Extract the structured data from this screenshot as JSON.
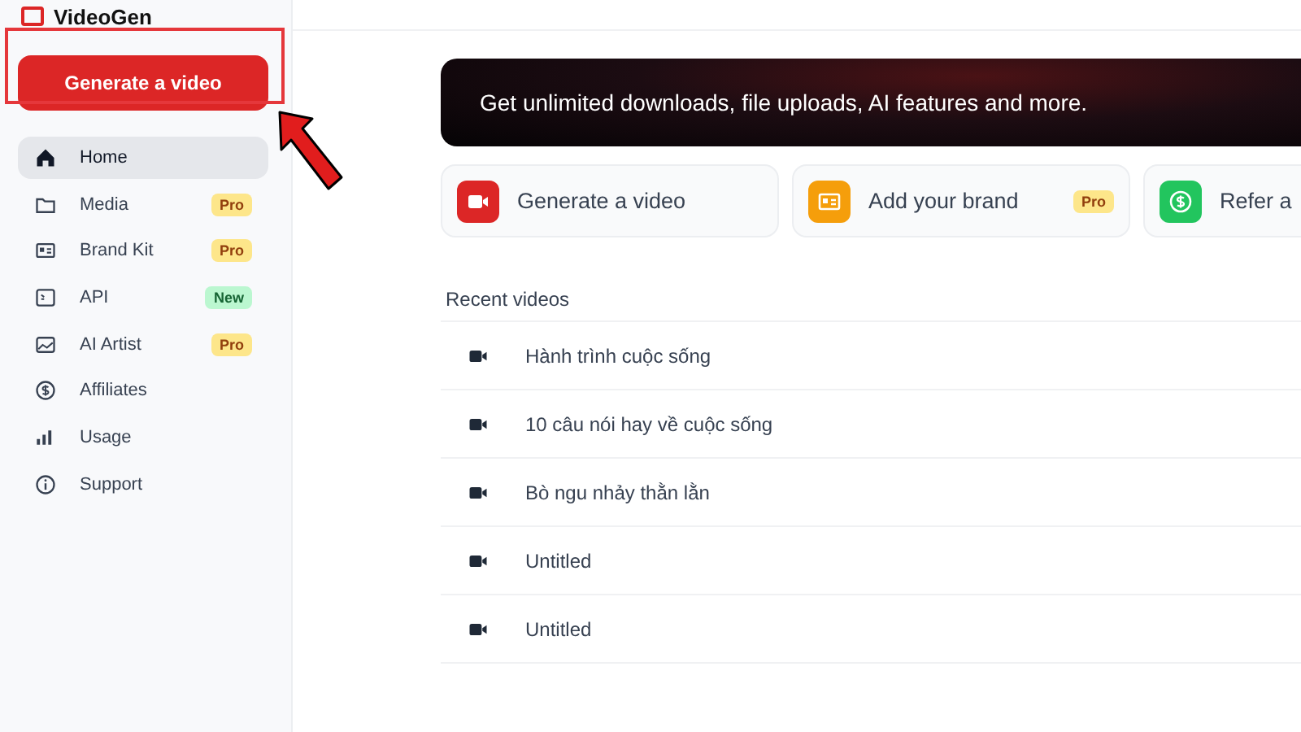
{
  "sidebar": {
    "logo": "VideoGen",
    "primary_button": "Generate a video",
    "items": [
      {
        "label": "Home",
        "selected": true
      },
      {
        "label": "Media",
        "selected": false,
        "badge": {
          "text": "Pro",
          "kind": "pro"
        }
      },
      {
        "label": "Brand Kit",
        "selected": false,
        "badge": {
          "text": "Pro",
          "kind": "pro"
        }
      },
      {
        "label": "API",
        "selected": false,
        "badge": {
          "text": "New",
          "kind": "new"
        }
      },
      {
        "label": "AI Artist",
        "selected": false,
        "badge": {
          "text": "Pro",
          "kind": "pro"
        }
      },
      {
        "label": "Affiliates",
        "selected": false
      },
      {
        "label": "Usage",
        "selected": false
      },
      {
        "label": "Support",
        "selected": false
      }
    ]
  },
  "banner": {
    "text": "Get unlimited downloads, file uploads, AI features and more."
  },
  "actions": [
    {
      "label": "Generate a video",
      "color": "#dc2626"
    },
    {
      "label": "Add your brand",
      "color": "#f59e0b",
      "badge": {
        "text": "Pro",
        "kind": "pro"
      }
    },
    {
      "label": "Refer a",
      "color": "#22c55e"
    }
  ],
  "recent": {
    "title": "Recent videos",
    "videos": [
      {
        "title": "Hành trình cuộc sống"
      },
      {
        "title": "10 câu nói hay về cuộc sống"
      },
      {
        "title": "Bò ngu nhảy thằn lằn"
      },
      {
        "title": "Untitled"
      },
      {
        "title": "Untitled"
      }
    ]
  }
}
